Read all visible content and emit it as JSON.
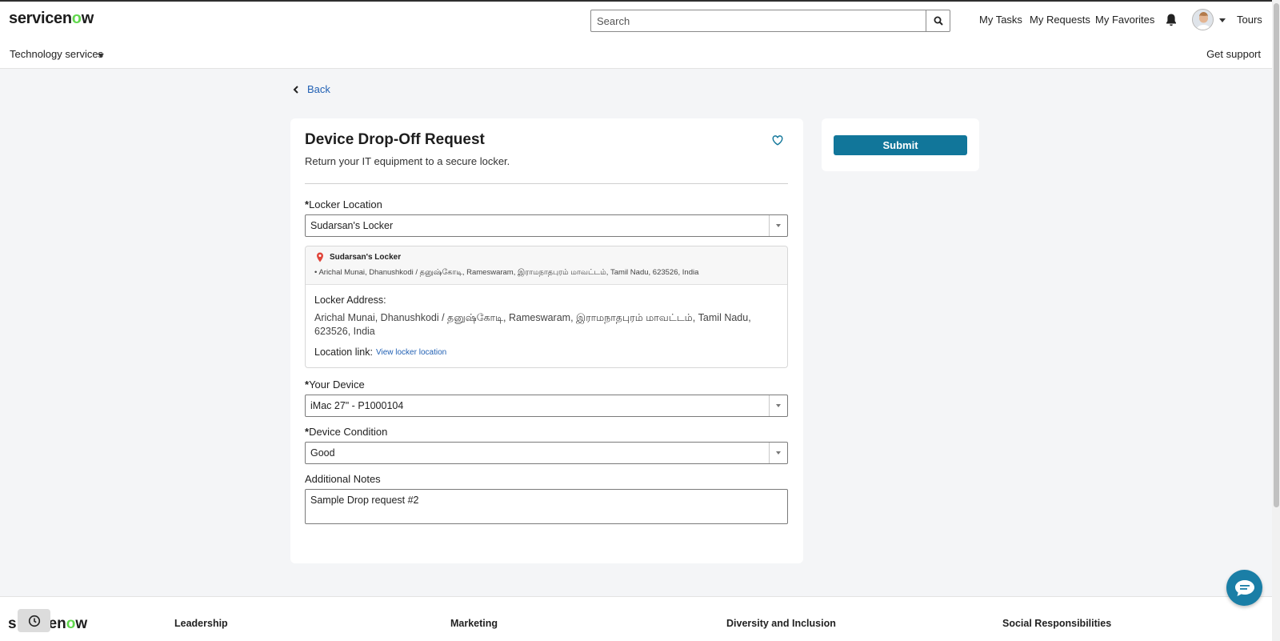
{
  "header": {
    "logo": {
      "pre": "servicen",
      "o": "o",
      "post": "w"
    },
    "search": {
      "placeholder": "Search",
      "value": ""
    },
    "nav": {
      "my_tasks": "My Tasks",
      "my_requests": "My Requests",
      "my_favorites": "My Favorites",
      "tours": "Tours"
    },
    "subnav": {
      "technology_services": "Technology services",
      "get_support": "Get support"
    }
  },
  "back_label": "Back",
  "form": {
    "title": "Device Drop-Off Request",
    "subtitle": "Return your IT equipment to a secure locker.",
    "required_marker": "*",
    "locker_location": {
      "label": "Locker Location",
      "value": "Sudarsan's Locker"
    },
    "locker_info": {
      "name": "Sudarsan's Locker",
      "address_short": "• Arichal Munai, Dhanushkodi / தனுஷ்கோடி, Rameswaram, இராமநாதபுரம் மாவட்டம், Tamil Nadu, 623526, India",
      "address_label": "Locker Address:",
      "address": "Arichal Munai, Dhanushkodi / தனுஷ்கோடி, Rameswaram, இராமநாதபுரம் மாவட்டம், Tamil Nadu, 623526, India",
      "link_label": "Location link:",
      "link_text": "View locker location"
    },
    "your_device": {
      "label": "Your Device",
      "value": "iMac 27\" - P1000104"
    },
    "device_condition": {
      "label": "Device Condition",
      "value": "Good"
    },
    "additional_notes": {
      "label": "Additional Notes",
      "value": "Sample Drop request #2"
    }
  },
  "submit_label": "Submit",
  "footer": {
    "logo_pre": "s",
    "logo_mid": "en",
    "logo_o": "o",
    "logo_post": "w",
    "columns": [
      "Leadership",
      "Marketing",
      "Diversity and Inclusion",
      "Social Responsibilities"
    ]
  },
  "colors": {
    "accent": "#11769a",
    "link": "#2261b4",
    "logo_green": "#62d84e",
    "chat": "#1a7ea6"
  },
  "icons": [
    "search-icon",
    "bell-icon",
    "chevron-left-icon",
    "heart-icon",
    "map-pin-icon",
    "clock-icon",
    "chat-icon"
  ]
}
